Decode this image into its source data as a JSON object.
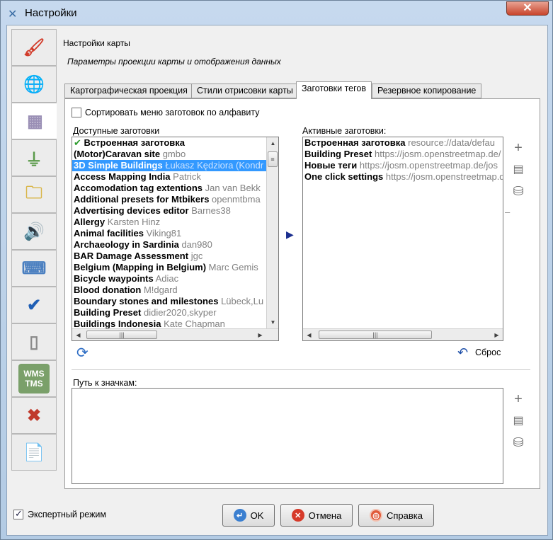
{
  "window": {
    "title": "Настройки",
    "close_symbol": "✕"
  },
  "sidebar": {
    "tabs": [
      {
        "name": "display",
        "icon": "paintbrush-icon",
        "symbol": "🖌",
        "color": "#d23b2a"
      },
      {
        "name": "projection",
        "icon": "globe-icon",
        "symbol": "🌐",
        "color": "#2d7fbf"
      },
      {
        "name": "map",
        "icon": "map-grid-icon",
        "symbol": "▦",
        "color": "#9a8fb5",
        "active": true
      },
      {
        "name": "connection",
        "icon": "plug-icon",
        "symbol": "⏚",
        "color": "#5a9a4a"
      },
      {
        "name": "files",
        "icon": "folders-icon",
        "symbol": "🗀",
        "color": "#d9b64a"
      },
      {
        "name": "audio",
        "icon": "speaker-icon",
        "symbol": "🔊",
        "color": "#3b5fa0"
      },
      {
        "name": "shortcuts",
        "icon": "keyboard-icon",
        "symbol": "⌨",
        "color": "#4a7fc0"
      },
      {
        "name": "validator",
        "icon": "checkmark-icon",
        "symbol": "✔",
        "color": "#1f5fb5"
      },
      {
        "name": "remote",
        "icon": "remote-control-icon",
        "symbol": "▯",
        "color": "#8a8a8a"
      },
      {
        "name": "imagery",
        "icon": "wms-tms-icon",
        "symbol": "WMS TMS",
        "color": "#7aa06a"
      },
      {
        "name": "advanced",
        "icon": "tools-icon",
        "symbol": "✖",
        "color": "#c0392b"
      },
      {
        "name": "plugins",
        "icon": "document-wrench-icon",
        "symbol": "📄",
        "color": "#a0a0a0"
      }
    ]
  },
  "panel": {
    "heading": "Настройки карты",
    "subheading": "Параметры проекции карты и отображения данных",
    "tabs": [
      {
        "label": "Картографическая проекция"
      },
      {
        "label": "Стили отрисовки карты"
      },
      {
        "label": "Заготовки тегов",
        "active": true
      },
      {
        "label": "Резервное копирование"
      }
    ]
  },
  "presets": {
    "sort_label": "Сортировать меню заготовок по алфавиту",
    "sort_checked": false,
    "available_label": "Доступные заготовки",
    "active_label": "Активные заготовки:",
    "available": [
      {
        "name": "Встроенная заготовка",
        "author": "",
        "builtin": true
      },
      {
        "name": "(Motor)Caravan site",
        "author": "gmbo"
      },
      {
        "name": "3D Simple Buildings",
        "author": "Łukasz Kędziora (Kondr",
        "selected": true
      },
      {
        "name": "Access Mapping India",
        "author": "Patrick"
      },
      {
        "name": "Accomodation tag extentions",
        "author": "Jan van Bekk"
      },
      {
        "name": "Additional presets for Mtbikers",
        "author": "openmtbma"
      },
      {
        "name": "Advertising devices editor",
        "author": "Barnes38"
      },
      {
        "name": "Allergy",
        "author": "Karsten Hinz"
      },
      {
        "name": "Animal facilities",
        "author": "Viking81"
      },
      {
        "name": "Archaeology in Sardinia",
        "author": "dan980"
      },
      {
        "name": "BAR Damage Assessment",
        "author": "jgc"
      },
      {
        "name": "Belgium (Mapping in Belgium)",
        "author": "Marc Gemis"
      },
      {
        "name": "Bicycle waypoints",
        "author": "Adiac"
      },
      {
        "name": "Blood donation",
        "author": "M!dgard"
      },
      {
        "name": "Boundary stones and milestones",
        "author": "Lübeck,Lu"
      },
      {
        "name": "Building Preset",
        "author": "didier2020,skyper"
      },
      {
        "name": "Buildings Indonesia",
        "author": "Kate Chapman"
      }
    ],
    "active": [
      {
        "name": "Встроенная заготовка",
        "source": "resource://data/defau"
      },
      {
        "name": "Building Preset",
        "source": "https://josm.openstreetmap.de/"
      },
      {
        "name": "Новые теги",
        "source": "https://josm.openstreetmap.de/jos"
      },
      {
        "name": "One click settings",
        "source": "https://josm.openstreetmap.de/"
      }
    ],
    "reset_label": "Сброс",
    "icon_path_label": "Путь к значкам:"
  },
  "footer": {
    "expert_label": "Экспертный режим",
    "expert_checked": true,
    "ok_label": "OK",
    "cancel_label": "Отмена",
    "help_label": "Справка"
  }
}
